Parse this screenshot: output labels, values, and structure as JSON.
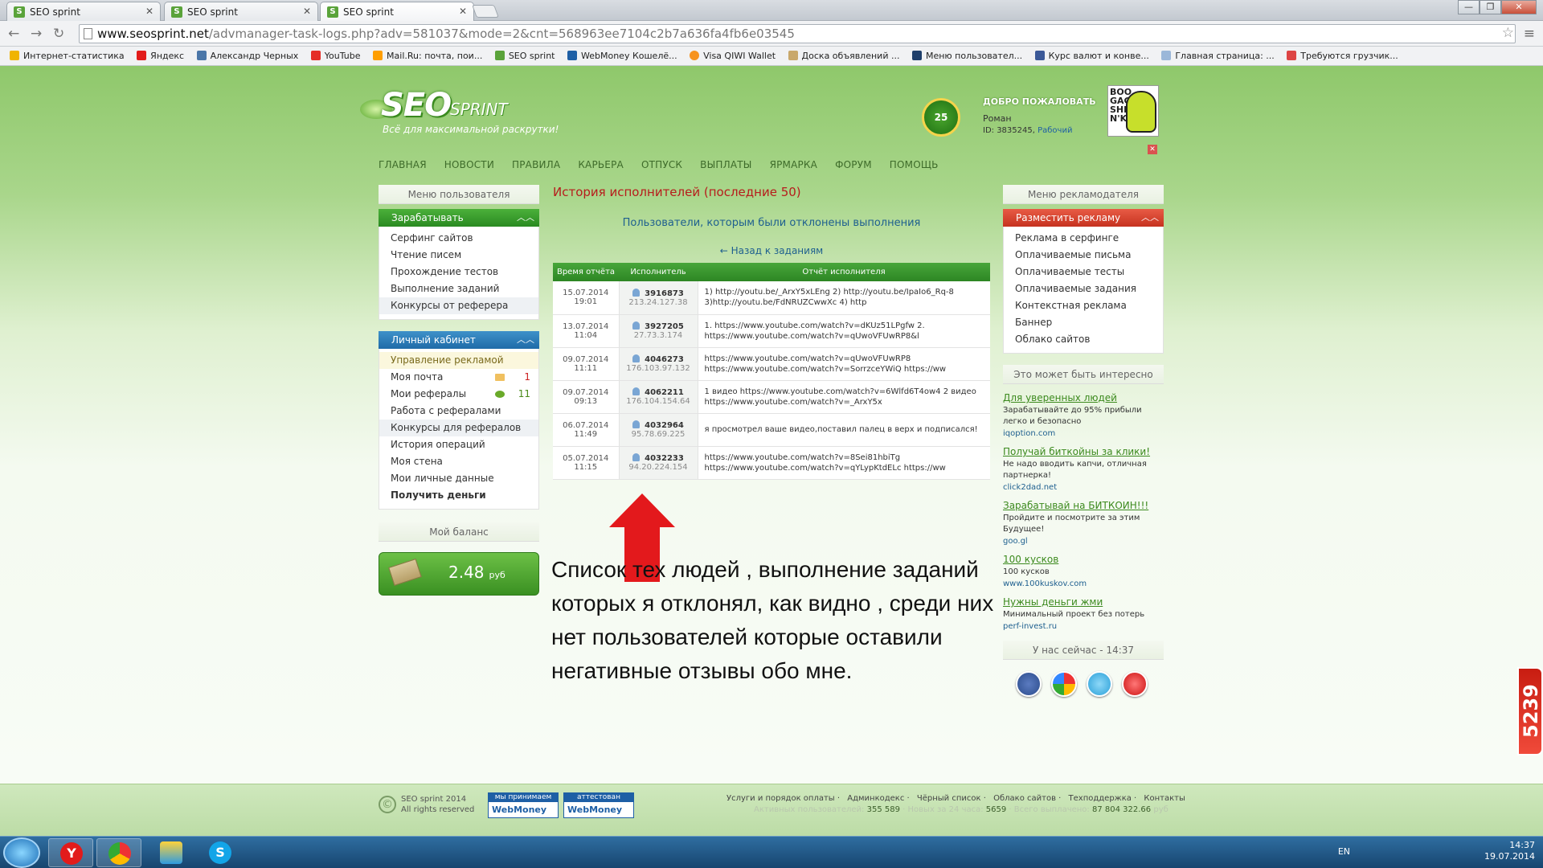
{
  "browser": {
    "tabs": [
      {
        "label": "SEO sprint"
      },
      {
        "label": "SEO sprint"
      },
      {
        "label": "SEO sprint"
      }
    ],
    "url_host": "www.seosprint.net",
    "url_path": "/advmanager-task-logs.php?adv=581037&mode=2&cnt=568963ee7104c2b7a636fa4fb6e03545",
    "bookmarks": [
      "Интернет-статистика",
      "Яндекс",
      "Александр Черных",
      "YouTube",
      "Mail.Ru: почта, пои...",
      "SEO sprint",
      "WebMoney Кошелё...",
      "Visa QIWI Wallet",
      "Доска объявлений ...",
      "Меню пользовател...",
      "Курс валют и конве...",
      "Главная страница: ...",
      "Требуются грузчик..."
    ]
  },
  "header": {
    "logo_seo": "SEO",
    "logo_sprint": "SPRINT",
    "logo_tagline": "Всё для максимальной раскрутки!",
    "level": "25",
    "welcome": "ДОБРО ПОЖАЛОВАТЬ",
    "user_name": "Роман",
    "user_id": "ID: 3835245,",
    "user_status": "Рабочий",
    "avatar_text": [
      "BOO",
      "GAGA",
      "SHE",
      "N'KA"
    ]
  },
  "nav": [
    "ГЛАВНАЯ",
    "НОВОСТИ",
    "ПРАВИЛА",
    "КАРЬЕРА",
    "ОТПУСК",
    "ВЫПЛАТЫ",
    "ЯРМАРКА",
    "ФОРУМ",
    "ПОМОЩЬ"
  ],
  "left": {
    "menu_title": "Меню пользователя",
    "earn_label": "Зарабатывать",
    "earn_items": [
      "Серфинг сайтов",
      "Чтение писем",
      "Прохождение тестов",
      "Выполнение заданий",
      "Конкурсы от реферера"
    ],
    "cabinet_label": "Личный кабинет",
    "cabinet_items": [
      {
        "label": "Управление рекламой"
      },
      {
        "label": "Моя почта",
        "count": "1"
      },
      {
        "label": "Мои рефералы",
        "count": "11"
      },
      {
        "label": "Работа с рефералами"
      },
      {
        "label": "Конкурсы для рефералов"
      },
      {
        "label": "История операций"
      },
      {
        "label": "Моя стена"
      },
      {
        "label": "Мои личные данные"
      },
      {
        "label": "Получить деньги"
      }
    ],
    "balance_title": "Мой баланс",
    "balance_amount": "2.48",
    "balance_currency": "руб"
  },
  "main": {
    "title": "История исполнителей (последние 50)",
    "subtitle": "Пользователи, которым были отклонены выполнения",
    "back": "← Назад к заданиям",
    "columns": [
      "Время отчёта",
      "Исполнитель",
      "Отчёт исполнителя"
    ],
    "rows": [
      {
        "date": "15.07.2014",
        "time": "19:01",
        "id": "3916873",
        "ip": "213.24.127.38",
        "r1": "1) http://youtu.be/_ArxY5xLEng 2) http://youtu.be/IpaIo6_Rq-8",
        "r2": "3)http://youtu.be/FdNRUZCwwXc 4) http"
      },
      {
        "date": "13.07.2014",
        "time": "11:04",
        "id": "3927205",
        "ip": "27.73.3.174",
        "r1": "1. https://www.youtube.com/watch?v=dKUz51LPgfw 2.",
        "r2": "https://www.youtube.com/watch?v=qUwoVFUwRP8&l"
      },
      {
        "date": "09.07.2014",
        "time": "11:11",
        "id": "4046273",
        "ip": "176.103.97.132",
        "r1": "https://www.youtube.com/watch?v=qUwoVFUwRP8",
        "r2": "https://www.youtube.com/watch?v=SorrzceYWiQ https://ww"
      },
      {
        "date": "09.07.2014",
        "time": "09:13",
        "id": "4062211",
        "ip": "176.104.154.64",
        "r1": "1 видео https://www.youtube.com/watch?v=6Wlfd6T4ow4 2 видео",
        "r2": "https://www.youtube.com/watch?v=_ArxY5x"
      },
      {
        "date": "06.07.2014",
        "time": "11:49",
        "id": "4032964",
        "ip": "95.78.69.225",
        "r1": "я просмотрел ваше видео,поставил палец в верх и подписался!",
        "r2": ""
      },
      {
        "date": "05.07.2014",
        "time": "11:15",
        "id": "4032233",
        "ip": "94.20.224.154",
        "r1": "https://www.youtube.com/watch?v=8Sei81hbiTg",
        "r2": "https://www.youtube.com/watch?v=qYLypKtdELc https://ww"
      }
    ],
    "annotation": "Список тех людей , выполнение заданий которых я отклонял, как видно , среди них нет пользователей которые оставили негативные отзывы обо мне."
  },
  "right": {
    "menu_title": "Меню рекламодателя",
    "place_label": "Разместить рекламу",
    "items": [
      "Реклама в серфинге",
      "Оплачиваемые письма",
      "Оплачиваемые тесты",
      "Оплачиваемые задания",
      "Контекстная реклама",
      "Баннер",
      "Облако сайтов"
    ],
    "interest_title": "Это может быть интересно",
    "ads": [
      {
        "title": "Для уверенных людей",
        "desc": "Зарабатывайте до 95% прибыли легко и безопасно",
        "host": "iqoption.com"
      },
      {
        "title": "Получай биткойны за клики!",
        "desc": "Не надо вводить капчи, отличная партнерка!",
        "host": "click2dad.net"
      },
      {
        "title": "Зарабатывай на БИТКОИН!!!",
        "desc": "Пройдите и посмотрите за этим Будущее!",
        "host": "goo.gl"
      },
      {
        "title": "100 кусков",
        "desc": "100 кусков",
        "host": "www.100kuskov.com"
      },
      {
        "title": "Нужны деньги жми",
        "desc": "Минимальный проект без потерь",
        "host": "perf-invest.ru"
      }
    ],
    "now_label": "У нас сейчас - 14:37",
    "side_badge": "5239"
  },
  "footer": {
    "copy1": "SEO sprint 2014",
    "copy2": "All rights reserved",
    "wm1_top": "мы принимаем",
    "wm1_bot": "WebMoney",
    "wm2_top": "аттестован",
    "wm2_bot": "WebMoney",
    "links": [
      "Услуги и порядок оплаты",
      "Админкодекс",
      "Чёрный список",
      "Облако сайтов",
      "Техподдержка",
      "Контакты"
    ],
    "stat1_label": "Активных пользователей:",
    "stat1": "355 589",
    "stat2_label": "Новых за 24 часа:",
    "stat2": "5659",
    "stat3_label": "Всего выплачено:",
    "stat3": "87 804 322.66",
    "stat3_unit": "руб"
  },
  "taskbar": {
    "lang": "EN",
    "time": "14:37",
    "date": "19.07.2014"
  },
  "colors": {
    "accent_green": "#2d8624",
    "link_blue": "#1e5f8f",
    "title_red": "#b71c1c",
    "arrow_red": "#e3191c"
  }
}
